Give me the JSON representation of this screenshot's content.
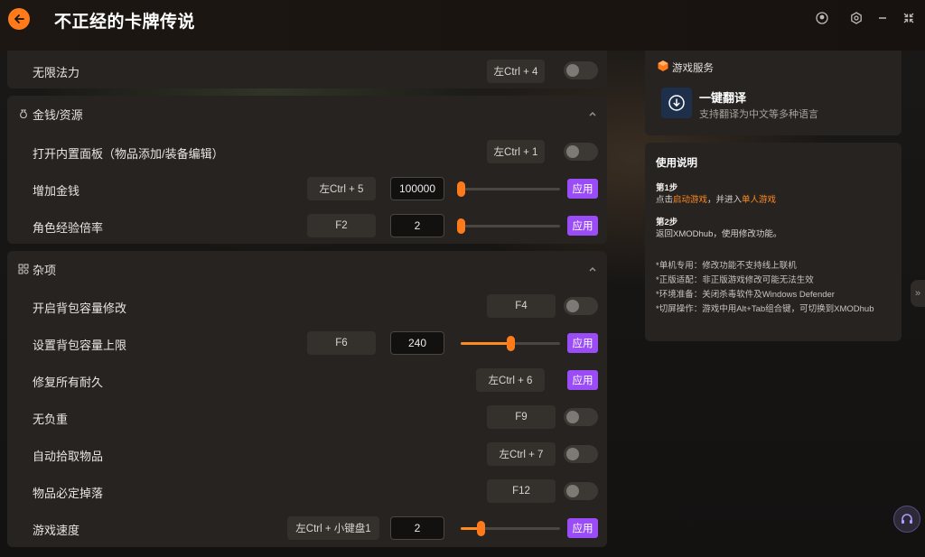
{
  "window": {
    "title": "不正经的卡牌传说"
  },
  "top_row": {
    "label": "无限法力",
    "hotkey": "左Ctrl + 4"
  },
  "money_section": {
    "title": "金钱/资源",
    "rows": [
      {
        "label": "打开内置面板（物品添加/装备编辑）",
        "hotkey": "左Ctrl + 1"
      },
      {
        "label": "增加金钱",
        "hotkey": "左Ctrl + 5",
        "value": "100000",
        "slider_fraction": 0.0,
        "apply": "应用"
      },
      {
        "label": "角色经验倍率",
        "hotkey": "F2",
        "value": "2",
        "slider_fraction": 0.0,
        "apply": "应用"
      }
    ]
  },
  "misc_section": {
    "title": "杂项",
    "rows": [
      {
        "label": "开启背包容量修改",
        "hotkey": "F4"
      },
      {
        "label": "设置背包容量上限",
        "hotkey": "F6",
        "value": "240",
        "slider_fraction": 0.5,
        "apply": "应用"
      },
      {
        "label": "修复所有耐久",
        "hotkey": "左Ctrl + 6",
        "apply": "应用"
      },
      {
        "label": "无负重",
        "hotkey": "F9"
      },
      {
        "label": "自动拾取物品",
        "hotkey": "左Ctrl + 7"
      },
      {
        "label": "物品必定掉落",
        "hotkey": "F12"
      },
      {
        "label": "游戏速度",
        "hotkey": "左Ctrl + 小键盘1",
        "value": "2",
        "slider_fraction": 0.2,
        "apply": "应用"
      }
    ]
  },
  "service": {
    "title": "游戏服务",
    "translate_title": "一键翻译",
    "translate_desc": "支持翻译为中文等多种语言"
  },
  "usage": {
    "title": "使用说明",
    "step1_title": "第1步",
    "step1_pre": "点击",
    "step1_hl1": "启动游戏",
    "step1_mid": "，并进入",
    "step1_hl2": "单人游戏",
    "step2_title": "第2步",
    "step2_text": "返回XMODhub，使用修改功能。",
    "notes": [
      "*单机专用：修改功能不支持线上联机",
      "*正版适配：非正版游戏修改可能无法生效",
      "*环境准备：关闭杀毒软件及Windows Defender",
      "*切屏操作：游戏中用Alt+Tab组合键，可切换到XMODhub"
    ]
  },
  "colors": {
    "accent": "#ff7a1a",
    "apply": "#9a4cf6",
    "panel": "#262320"
  }
}
